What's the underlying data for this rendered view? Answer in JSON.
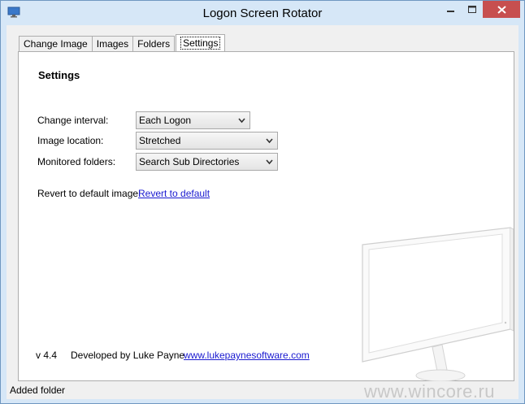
{
  "window": {
    "title": "Logon Screen Rotator",
    "colors": {
      "frame": "#d6e7f7",
      "close_button": "#c74f4f",
      "link": "#1a1ad0"
    }
  },
  "tabs": [
    {
      "label": "Change Image",
      "active": false
    },
    {
      "label": "Images",
      "active": false
    },
    {
      "label": "Folders",
      "active": false
    },
    {
      "label": "Settings",
      "active": true
    }
  ],
  "settings": {
    "heading": "Settings",
    "change_interval": {
      "label": "Change interval:",
      "value": "Each Logon"
    },
    "image_location": {
      "label": "Image location:",
      "value": "Stretched"
    },
    "monitored_folders": {
      "label": "Monitored folders:",
      "value": "Search Sub Directories"
    },
    "revert": {
      "label": "Revert to default image:",
      "link": "Revert to default"
    }
  },
  "footer": {
    "version": "v 4.4",
    "developer": "Developed by Luke Payne",
    "website": "www.lukepaynesoftware.com"
  },
  "statusbar": {
    "text": "Added folder"
  },
  "watermark": "www.wincore.ru",
  "icons": {
    "app": "monitor-icon",
    "minimize": "minimize-icon",
    "maximize": "maximize-icon",
    "close": "close-icon",
    "dropdown": "chevron-down-icon"
  }
}
